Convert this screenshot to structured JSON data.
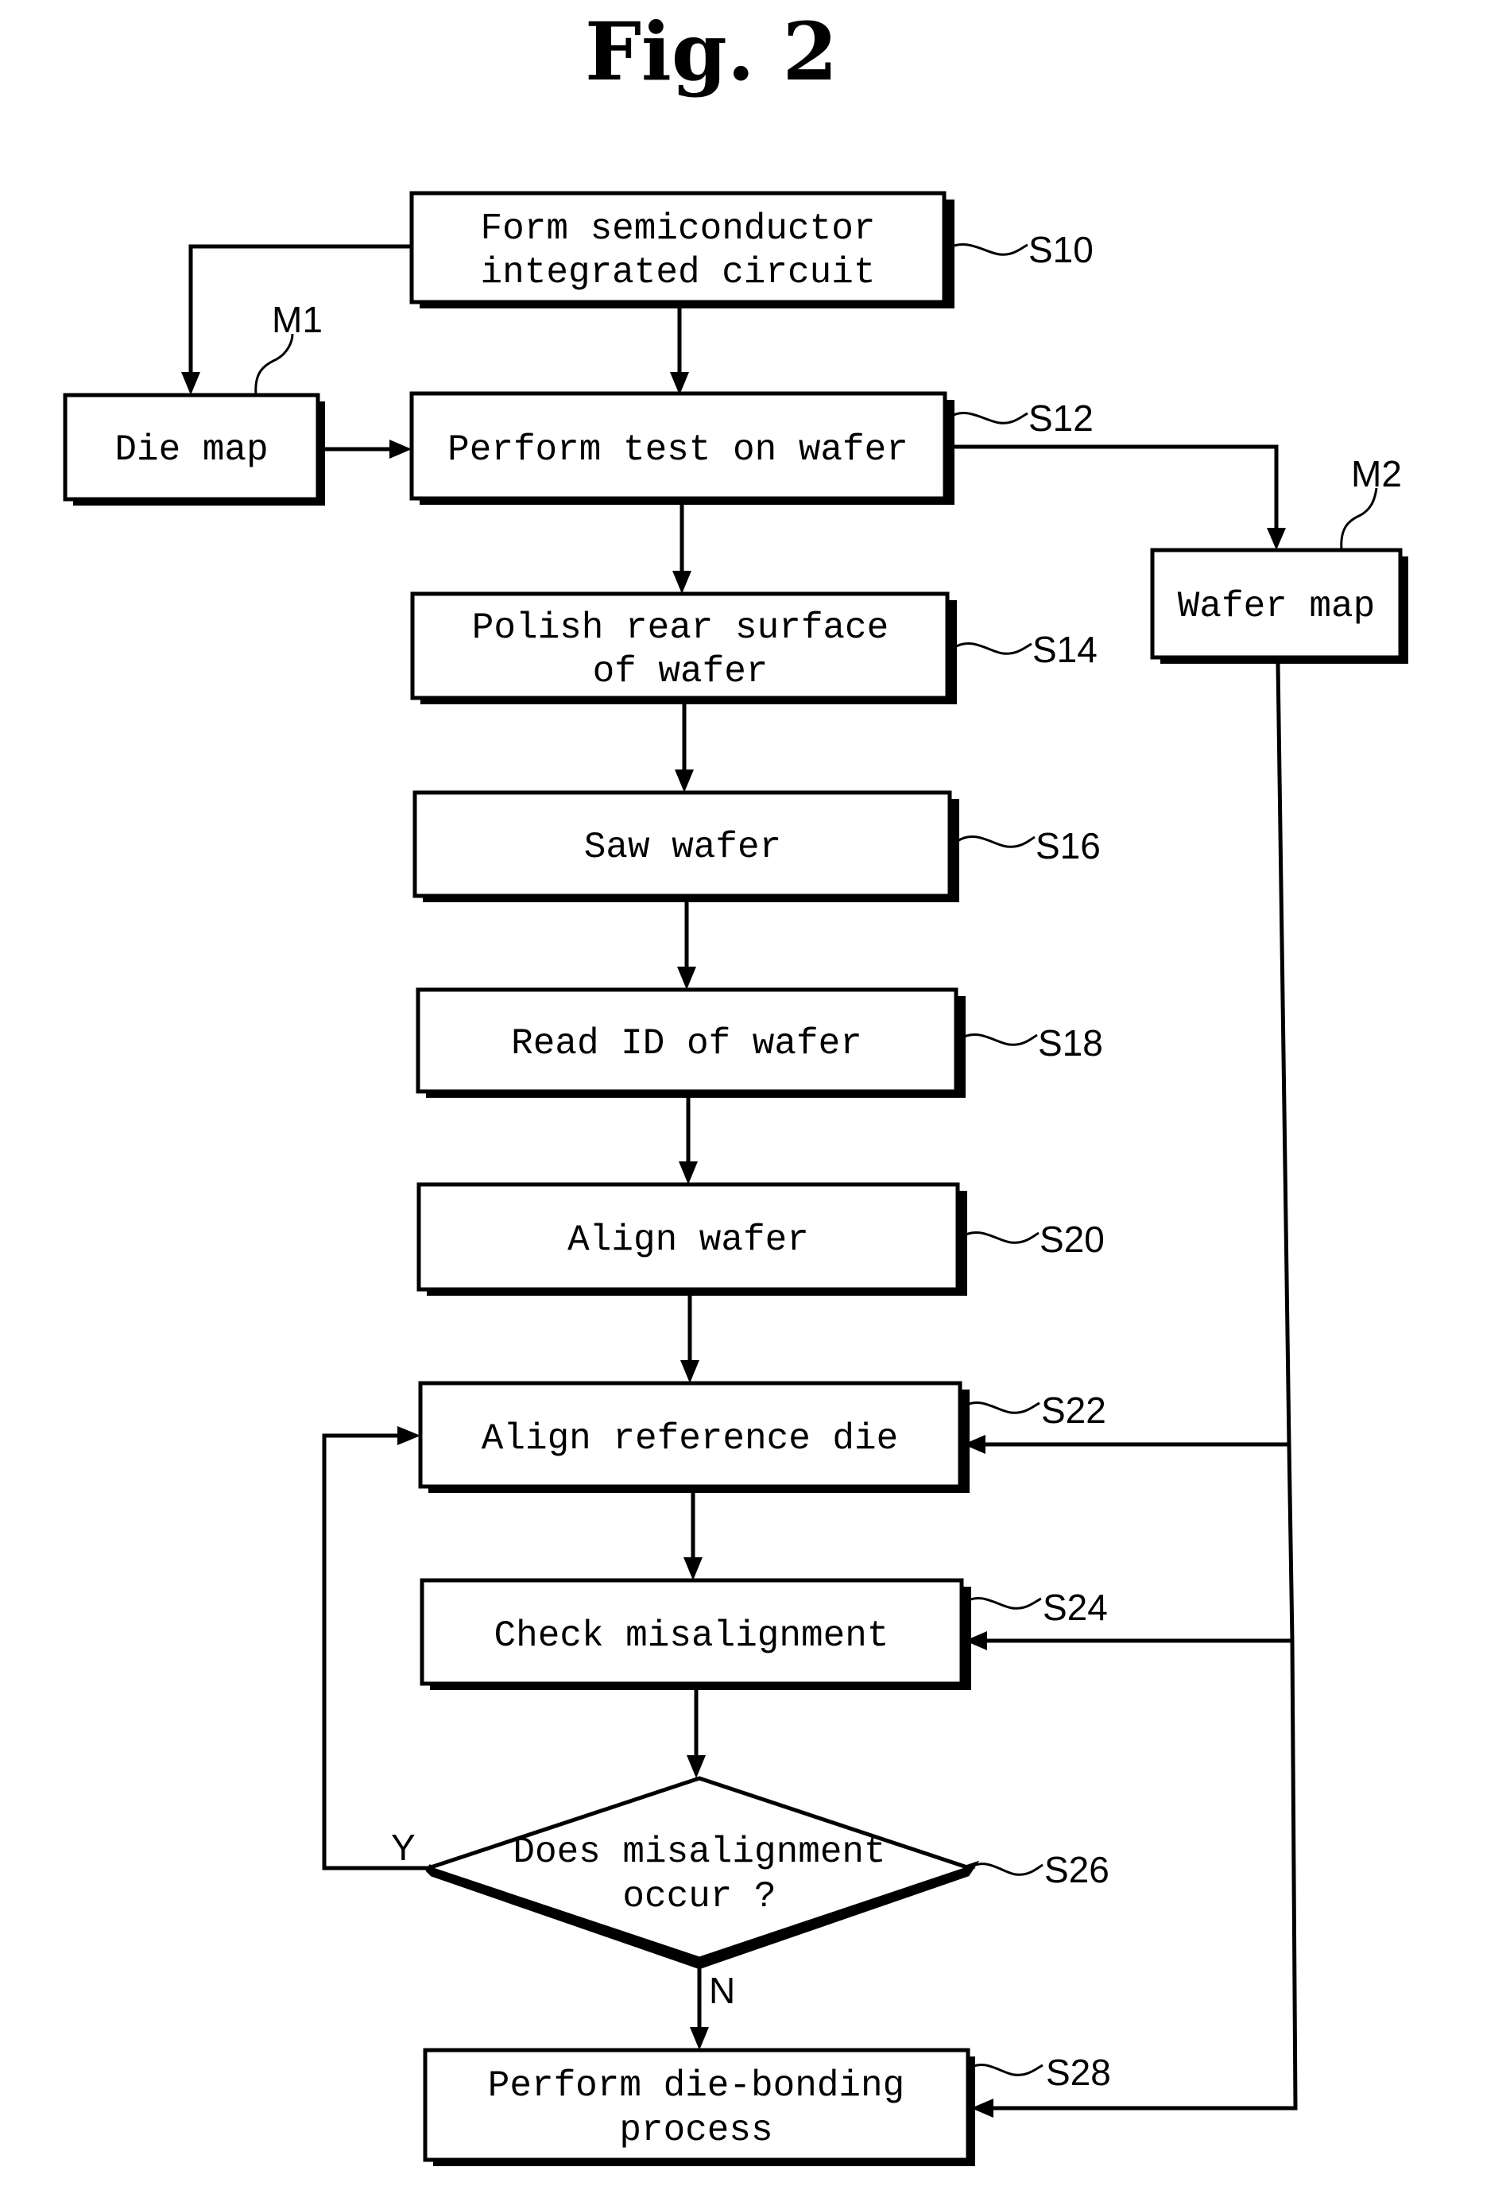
{
  "figure": {
    "title": "Fig. 2"
  },
  "steps": [
    {
      "id": "S10",
      "ref": "S10",
      "lines": [
        "Form semiconductor",
        "integrated circuit"
      ]
    },
    {
      "id": "S12",
      "ref": "S12",
      "lines": [
        "Perform test on wafer"
      ]
    },
    {
      "id": "S14",
      "ref": "S14",
      "lines": [
        "Polish rear surface",
        "of wafer"
      ]
    },
    {
      "id": "S16",
      "ref": "S16",
      "lines": [
        "Saw wafer"
      ]
    },
    {
      "id": "S18",
      "ref": "S18",
      "lines": [
        "Read ID of wafer"
      ]
    },
    {
      "id": "S20",
      "ref": "S20",
      "lines": [
        "Align wafer"
      ]
    },
    {
      "id": "S22",
      "ref": "S22",
      "lines": [
        "Align reference die"
      ]
    },
    {
      "id": "S24",
      "ref": "S24",
      "lines": [
        "Check misalignment"
      ]
    },
    {
      "id": "S26",
      "ref": "S26",
      "lines": [
        "Does misalignment",
        "occur ?"
      ],
      "shape": "decision"
    },
    {
      "id": "S28",
      "ref": "S28",
      "lines": [
        "Perform die-bonding",
        "process"
      ]
    }
  ],
  "maps": [
    {
      "id": "M1",
      "ref": "M1",
      "label": "Die map"
    },
    {
      "id": "M2",
      "ref": "M2",
      "label": "Wafer map"
    }
  ],
  "branches": {
    "yes": "Y",
    "no": "N"
  },
  "edges": [
    {
      "from": "S10",
      "to": "S12"
    },
    {
      "from": "S10",
      "to": "M1"
    },
    {
      "from": "M1",
      "to": "S12"
    },
    {
      "from": "S12",
      "to": "M2"
    },
    {
      "from": "S12",
      "to": "S14"
    },
    {
      "from": "S14",
      "to": "S16"
    },
    {
      "from": "S16",
      "to": "S18"
    },
    {
      "from": "S18",
      "to": "S20"
    },
    {
      "from": "S20",
      "to": "S22"
    },
    {
      "from": "S22",
      "to": "S24"
    },
    {
      "from": "S24",
      "to": "S26"
    },
    {
      "from": "S26",
      "to": "S22",
      "label": "Y"
    },
    {
      "from": "S26",
      "to": "S28",
      "label": "N"
    },
    {
      "from": "M2",
      "to": "S22"
    },
    {
      "from": "M2",
      "to": "S24"
    },
    {
      "from": "M2",
      "to": "S28"
    }
  ]
}
